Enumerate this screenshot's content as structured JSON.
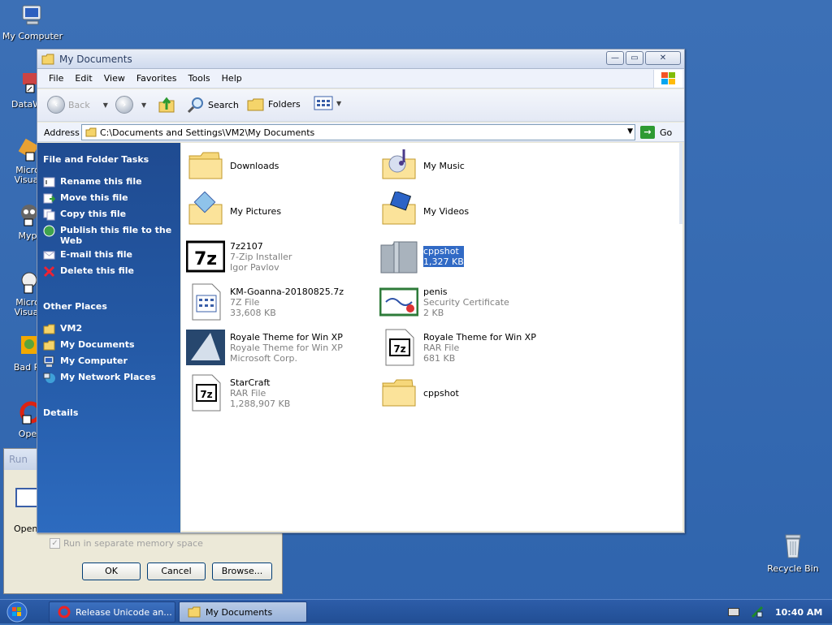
{
  "desktop": {
    "icons": [
      {
        "label": "My Computer"
      },
      {
        "label": "DataWi"
      },
      {
        "label": "Micro\nVisual"
      },
      {
        "label": "Myp"
      },
      {
        "label": "Micro\nVisual"
      },
      {
        "label": "Bad Pi"
      },
      {
        "label": "Ope"
      }
    ],
    "recycle_bin": "Recycle Bin"
  },
  "run_dialog": {
    "title": "Run",
    "open_label": "Open",
    "checkbox_label": "Run in separate memory space",
    "ok": "OK",
    "cancel": "Cancel",
    "browse": "Browse..."
  },
  "window": {
    "title": "My Documents",
    "menu": [
      "File",
      "Edit",
      "View",
      "Favorites",
      "Tools",
      "Help"
    ],
    "toolbar": {
      "back": "Back",
      "search": "Search",
      "folders": "Folders"
    },
    "address": {
      "label": "Address",
      "path": "C:\\Documents and Settings\\VM2\\My Documents",
      "go": "Go"
    }
  },
  "taskpane": {
    "file_tasks_title": "File and Folder Tasks",
    "file_tasks": [
      "Rename this file",
      "Move this file",
      "Copy this file",
      "Publish this file to the Web",
      "E-mail this file",
      "Delete this file"
    ],
    "other_places_title": "Other Places",
    "other_places": [
      "VM2",
      "My Documents",
      "My Computer",
      "My Network Places"
    ],
    "details_title": "Details"
  },
  "files": [
    {
      "name": "Downloads",
      "line2": "",
      "line3": "",
      "icon": "folder-icon"
    },
    {
      "name": "My Music",
      "line2": "",
      "line3": "",
      "icon": "music-folder-icon"
    },
    {
      "name": "My Pictures",
      "line2": "",
      "line3": "",
      "icon": "pictures-folder-icon"
    },
    {
      "name": "My Videos",
      "line2": "",
      "line3": "",
      "icon": "videos-folder-icon"
    },
    {
      "name": "7z2107",
      "line2": "7-Zip Installer",
      "line3": "Igor Pavlov",
      "icon": "7z-installer-icon"
    },
    {
      "name": "cppshot",
      "line2": "1,327 KB",
      "line3": "",
      "icon": "zip-icon",
      "selected": true
    },
    {
      "name": "KM-Goanna-20180825.7z",
      "line2": "7Z File",
      "line3": "33,608 KB",
      "icon": "7z-file-icon"
    },
    {
      "name": "penis",
      "line2": "Security Certificate",
      "line3": "2 KB",
      "icon": "certificate-icon"
    },
    {
      "name": "Royale Theme for Win XP",
      "line2": "Royale Theme for Win XP",
      "line3": "Microsoft Corp.",
      "icon": "installer-icon"
    },
    {
      "name": "Royale Theme for Win XP",
      "line2": "RAR File",
      "line3": "681 KB",
      "icon": "rar-file-icon"
    },
    {
      "name": "StarCraft",
      "line2": "RAR File",
      "line3": "1,288,907 KB",
      "icon": "rar-file-icon"
    },
    {
      "name": "cppshot",
      "line2": "",
      "line3": "",
      "icon": "folder-icon"
    }
  ],
  "taskbar": {
    "buttons": [
      "Release Unicode an...",
      "My Documents"
    ],
    "clock": "10:40 AM"
  }
}
